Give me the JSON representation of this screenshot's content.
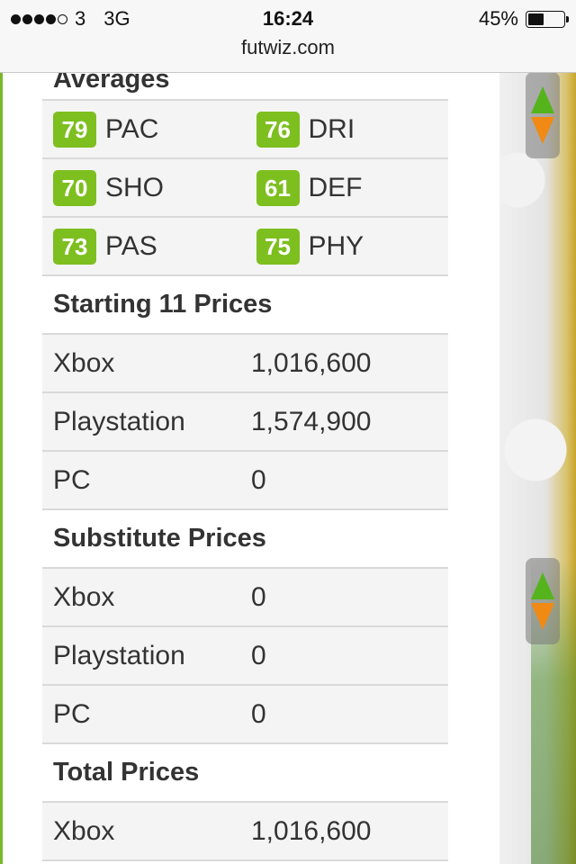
{
  "status_bar": {
    "carrier": "3",
    "network": "3G",
    "time": "16:24",
    "battery_percent": "45%",
    "battery_level": 0.45,
    "url": "futwiz.com"
  },
  "averages": {
    "title": "Averages",
    "rows": [
      [
        {
          "value": "79",
          "label": "PAC"
        },
        {
          "value": "76",
          "label": "DRI"
        }
      ],
      [
        {
          "value": "70",
          "label": "SHO"
        },
        {
          "value": "61",
          "label": "DEF"
        }
      ],
      [
        {
          "value": "73",
          "label": "PAS"
        },
        {
          "value": "75",
          "label": "PHY"
        }
      ]
    ]
  },
  "starting_prices": {
    "title": "Starting 11 Prices",
    "rows": [
      {
        "platform": "Xbox",
        "price": "1,016,600"
      },
      {
        "platform": "Playstation",
        "price": "1,574,900"
      },
      {
        "platform": "PC",
        "price": "0"
      }
    ]
  },
  "substitute_prices": {
    "title": "Substitute Prices",
    "rows": [
      {
        "platform": "Xbox",
        "price": "0"
      },
      {
        "platform": "Playstation",
        "price": "0"
      },
      {
        "platform": "PC",
        "price": "0"
      }
    ]
  },
  "total_prices": {
    "title": "Total Prices",
    "rows": [
      {
        "platform": "Xbox",
        "price": "1,016,600"
      }
    ]
  },
  "colors": {
    "badge_green": "#7dbf1f",
    "arrow_up": "#55b41c",
    "arrow_down": "#f08a14"
  },
  "icons": [
    "signal-dots-icon",
    "battery-icon",
    "scroll-up-arrow-icon",
    "scroll-down-arrow-icon"
  ]
}
